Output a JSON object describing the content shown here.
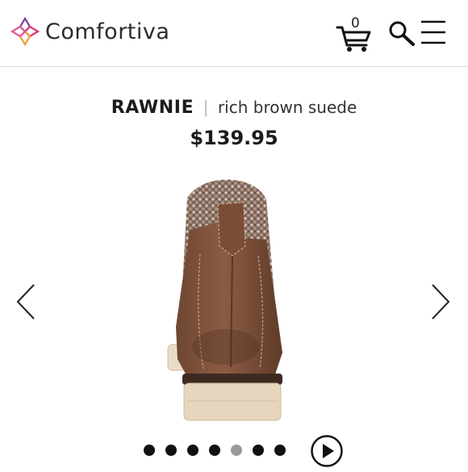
{
  "header": {
    "brand": "Comfortiva",
    "cart_count": "0",
    "icons": [
      "logo-flower-icon",
      "cart-icon",
      "search-icon",
      "menu-icon"
    ]
  },
  "product": {
    "name": "RAWNIE",
    "separator": "|",
    "color": "rich brown suede",
    "price": "$139.95"
  },
  "gallery": {
    "image_count": 7,
    "active_index": 4,
    "icons": [
      "chevron-left-icon",
      "chevron-right-icon",
      "play-icon"
    ]
  },
  "colors": {
    "text": "#1c1c1c",
    "divider": "#d9d9d9",
    "dot_active": "#9a9a9a",
    "dot": "#111111",
    "logo_pink": "#d8357a",
    "logo_orange": "#f39a3b",
    "logo_purple": "#7b3fa0"
  }
}
